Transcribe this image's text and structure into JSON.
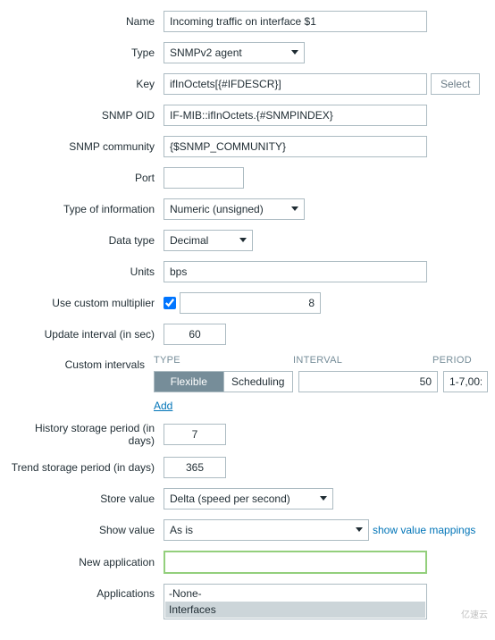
{
  "labels": {
    "name": "Name",
    "type": "Type",
    "key": "Key",
    "snmp_oid": "SNMP OID",
    "snmp_community": "SNMP community",
    "port": "Port",
    "type_of_info": "Type of information",
    "data_type": "Data type",
    "units": "Units",
    "use_multiplier": "Use custom multiplier",
    "update_interval": "Update interval (in sec)",
    "custom_intervals": "Custom intervals",
    "history_period": "History storage period (in days)",
    "trend_period": "Trend storage period (in days)",
    "store_value": "Store value",
    "show_value": "Show value",
    "new_application": "New application",
    "applications": "Applications"
  },
  "values": {
    "name": "Incoming traffic on interface $1",
    "type": "SNMPv2 agent",
    "key": "ifInOctets[{#IFDESCR}]",
    "select_btn": "Select",
    "snmp_oid": "IF-MIB::ifInOctets.{#SNMPINDEX}",
    "snmp_community": "{$SNMP_COMMUNITY}",
    "port": "",
    "type_of_info": "Numeric (unsigned)",
    "data_type": "Decimal",
    "units": "bps",
    "multiplier_checked": true,
    "multiplier": "8",
    "update_interval": "60",
    "history_period": "7",
    "trend_period": "365",
    "store_value": "Delta (speed per second)",
    "show_value": "As is",
    "show_value_link": "show value mappings",
    "new_application": "",
    "applications": [
      "-None-",
      "Interfaces"
    ],
    "applications_selected_index": 1
  },
  "custom_intervals": {
    "head_type": "TYPE",
    "head_interval": "INTERVAL",
    "head_period": "PERIOD",
    "tab_flexible": "Flexible",
    "tab_scheduling": "Scheduling",
    "interval": "50",
    "period": "1-7,00:",
    "add": "Add"
  },
  "watermark": "亿速云"
}
